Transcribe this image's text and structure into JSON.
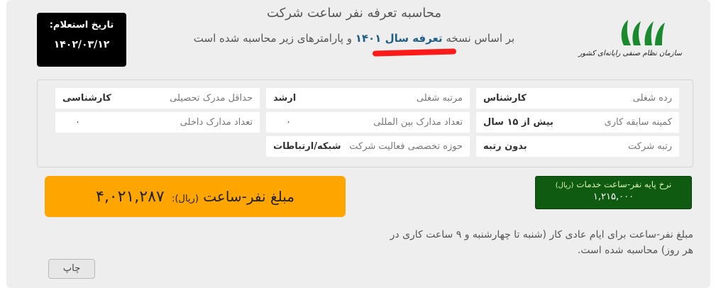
{
  "header": {
    "title": "محاسبه تعرفه نفر ساعت شرکت",
    "subtitle_pre": "بر اساس نسخه",
    "subtitle_highlight": "تعرفه سال ۱۴۰۱",
    "subtitle_post": "و پارامترهای زیر محاسبه شده است",
    "logo_text": "سازمان نظام صنفی رایانه‌ای کشور"
  },
  "inquiry": {
    "label": "تاریخ استعلام:",
    "date": "۱۴۰۲/۰۳/۱۲"
  },
  "params": {
    "job_rank_label": "رده شغلی",
    "job_rank_value": "کارشناس",
    "job_level_label": "مرتبه شغلی",
    "job_level_value": "ارشد",
    "min_degree_label": "حداقل مدرک تحصیلی",
    "min_degree_value": "کارشناسی",
    "min_experience_label": "کمینه سابقه کاری",
    "min_experience_value": "بیش از ۱۵ سال",
    "intl_certs_label": "تعداد مدارک بین المللی",
    "intl_certs_value": "۰",
    "domestic_certs_label": "تعداد مدارک داخلی",
    "domestic_certs_value": "۰",
    "company_rank_label": "رتبه شرکت",
    "company_rank_value": "بدون رتبه",
    "specialty_label": "حوزه تخصصی فعالیت شرکت",
    "specialty_value": "شبکه/ارتباطات"
  },
  "base_rate": {
    "label": "نرخ پایه نفر-ساعت خدمات",
    "unit": "(ریال)",
    "value": "۱,۲۱۵,۰۰۰"
  },
  "amount": {
    "label": "مبلغ نفر-ساعت",
    "unit": "(ریال):",
    "value": "۴,۰۲۱,۲۸۷"
  },
  "note": "مبلغ نفر-ساعت برای ایام عادی کار (شنبه تا چهارشنبه و ۹ ساعت کاری در هر روز) محاسبه شده است.",
  "actions": {
    "print_label": "چاپ"
  },
  "colors": {
    "amount_bg": "#ffa500",
    "base_rate_bg": "#0f5b12",
    "highlight_text": "#1f5f86",
    "underline_mark": "#ff1a1a"
  }
}
